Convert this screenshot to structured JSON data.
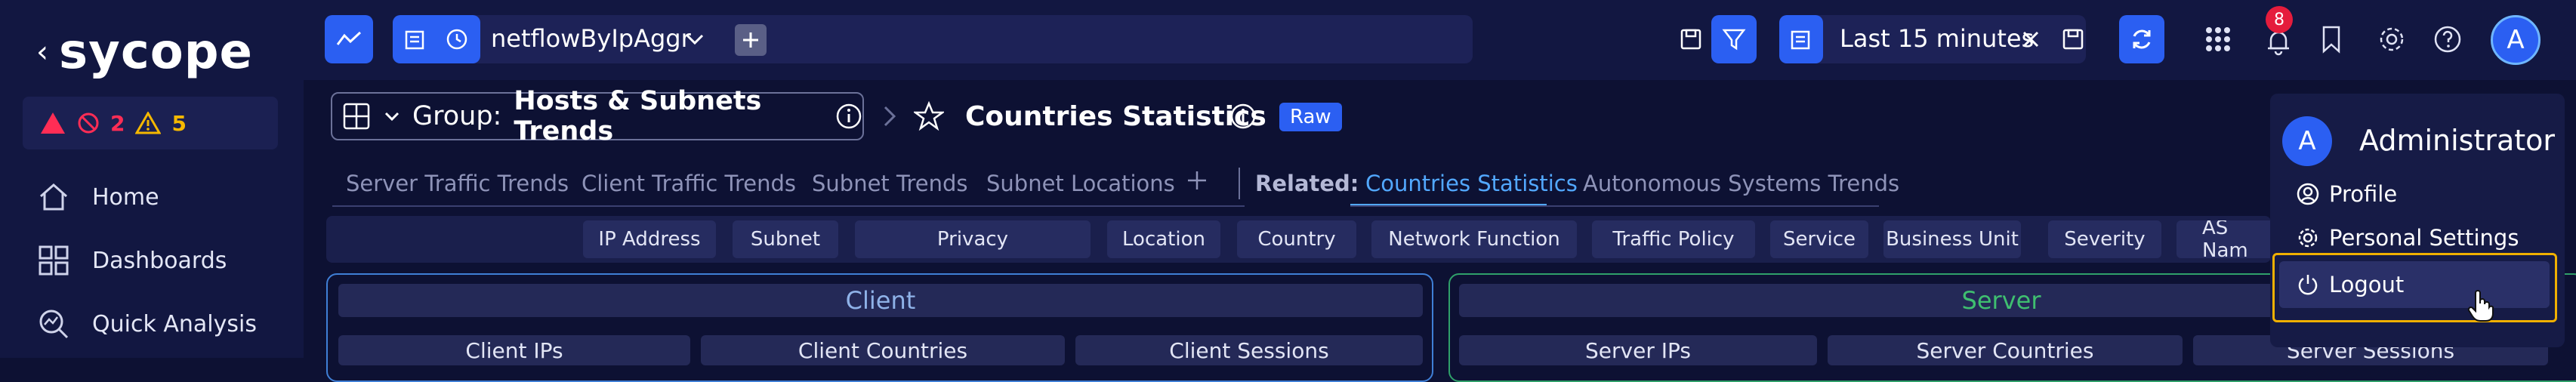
{
  "sidebar": {
    "logo_text": "sycope",
    "alerts": {
      "critical": "2",
      "warning": "5"
    },
    "nav": [
      {
        "label": "Home"
      },
      {
        "label": "Dashboards"
      },
      {
        "label": "Quick Analysis"
      }
    ]
  },
  "topbar": {
    "query_name": "netflowByIpAggr",
    "time_range": "Last 15 minutes",
    "notification_count": "8",
    "avatar_letter": "A"
  },
  "breadcrumb": {
    "group_prefix": "Group:",
    "group_name": "Hosts & Subnets Trends",
    "page_title": "Countries Statistics",
    "badge": "Raw"
  },
  "tabs": {
    "items": [
      "Server Traffic Trends",
      "Client Traffic Trends",
      "Subnet Trends",
      "Subnet Locations"
    ],
    "related_label": "Related:",
    "related": [
      "Countries Statistics",
      "Autonomous Systems Trends"
    ]
  },
  "filters": [
    "IP Address",
    "Subnet",
    "Privacy",
    "Location",
    "Country",
    "Network Function",
    "Traffic Policy",
    "Service",
    "Business Unit",
    "Severity",
    "AS Nam"
  ],
  "panels": {
    "client": {
      "title": "Client",
      "columns": [
        "Client IPs",
        "Client Countries",
        "Client Sessions"
      ]
    },
    "server": {
      "title": "Server",
      "columns": [
        "Server IPs",
        "Server Countries",
        "Server Sessions"
      ]
    }
  },
  "account_menu": {
    "name": "Administrator",
    "avatar_letter": "A",
    "items": [
      "Profile",
      "Personal Settings",
      "Logout"
    ]
  },
  "colors": {
    "accent": "#2b5ff2",
    "client_border": "#3f7fd6",
    "server_border": "#2fa06a",
    "server_title": "#3fbf70",
    "highlight": "#f0b000"
  }
}
